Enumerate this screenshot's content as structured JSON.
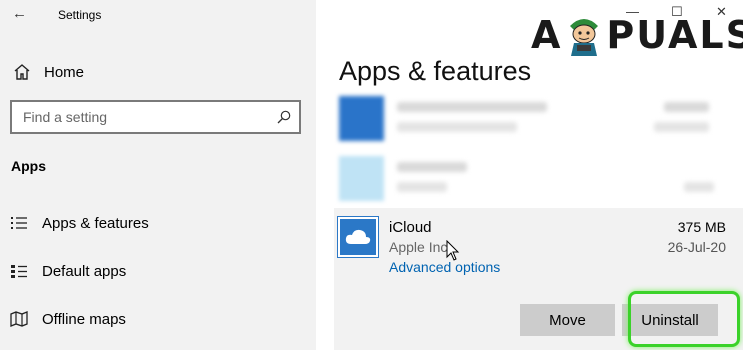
{
  "window": {
    "title": "Settings",
    "back_icon": "back-arrow-icon",
    "controls": [
      "minimize-icon",
      "maximize-icon",
      "close-icon"
    ]
  },
  "sidebar": {
    "home_label": "Home",
    "search_placeholder": "Find a setting",
    "section_label": "Apps",
    "items": [
      {
        "label": "Apps & features",
        "icon": "apps-features-icon"
      },
      {
        "label": "Default apps",
        "icon": "default-apps-icon"
      },
      {
        "label": "Offline maps",
        "icon": "offline-maps-icon"
      }
    ]
  },
  "main": {
    "title": "Apps & features",
    "watermark": "APPUALS",
    "selected_app": {
      "name": "iCloud",
      "publisher": "Apple Inc.",
      "size": "375 MB",
      "date": "26-Jul-20",
      "advanced_link": "Advanced options",
      "move_label": "Move",
      "uninstall_label": "Uninstall",
      "icon": "icloud-icon"
    }
  },
  "colors": {
    "accent_link": "#0063b1",
    "highlight_ring": "#3bd22a",
    "icon_blue": "#2b78c7",
    "sidebar_bg": "#f2f2f2"
  }
}
